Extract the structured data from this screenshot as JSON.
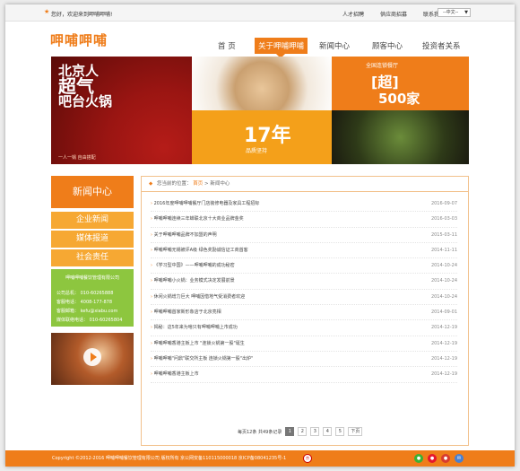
{
  "topbar": {
    "welcome": "您好，欢迎来到呷哺呷哺!",
    "links": [
      "人才招聘",
      "供应商招募",
      "联系我们"
    ],
    "language": "--中文--"
  },
  "header": {
    "logo": "呷哺呷哺",
    "nav": [
      {
        "label": "首 页"
      },
      {
        "label": "关于呷哺呷哺"
      },
      {
        "label": "新闻中心"
      },
      {
        "label": "顾客中心"
      },
      {
        "label": "投资者关系"
      }
    ]
  },
  "banner": {
    "panel1_line1": "北京人",
    "panel1_line2": "超气",
    "panel1_line3": "吧台火锅",
    "panel1_foot": "一人一锅 自由搭配",
    "panel3_num": "17年",
    "panel3_sub": "品质坚持",
    "panel4_line1": "全国连锁餐厅",
    "panel4_line2": "[超]",
    "panel4_line3": "500家"
  },
  "sidebar": {
    "title": "新闻中心",
    "items": [
      "企业新闻",
      "媒体报道",
      "社会责任"
    ],
    "contact": {
      "company": "呷哺呷哺餐饮管理有限公司",
      "phone": "公司总机： 010-60265888",
      "hotline": "客服电话： 4008-177-878",
      "email": "客服邮箱： kefu@xiabu.com",
      "media": "媒体联络电话： 010-60265804"
    }
  },
  "breadcrumb": {
    "prefix": "您当前的位置：",
    "home": "首页",
    "sep": ">",
    "current": "新闻中心"
  },
  "news": [
    {
      "title": "2016年度呷哺呷哺餐厅门店装修电器及家具工程招标",
      "date": "2016-09-07"
    },
    {
      "title": "呷哺呷哺连续三年蝉联北京十大商业品牌金奖",
      "date": "2016-03-03"
    },
    {
      "title": "关于呷哺呷哺品牌不加盟的声明",
      "date": "2015-03-11"
    },
    {
      "title": "呷哺呷哺无锡被评A级 绿色奖励诚信证工商首客",
      "date": "2014-11-11"
    },
    {
      "title": "《学习型中国》——呷哺呷哺的成功秘密",
      "date": "2014-10-24"
    },
    {
      "title": "呷哺呷哺小火锅：业务模式决定发展前景",
      "date": "2014-10-24"
    },
    {
      "title": "休闲火锅增力巨大 呷哺因借地气受消费者欢迎",
      "date": "2014-10-24"
    },
    {
      "title": "呷哺呷哺首家新形象店于北京亮相",
      "date": "2014-09-01"
    },
    {
      "title": "揭秘：这5年来为啥只有呷哺呷哺上市成功",
      "date": "2014-12-19"
    },
    {
      "title": "呷哺呷哺香港主板上市 \"连锁火锅第一股\"诞生",
      "date": "2014-12-19"
    },
    {
      "title": "呷哺呷哺\"问鼎\"联交所主板 连锁火锅第一股\"出炉\"",
      "date": "2014-12-19"
    },
    {
      "title": "呷哺呷哺香港主板上市",
      "date": "2014-12-19"
    }
  ],
  "pager": {
    "info": "每页12条 共49条记录",
    "pages": [
      "1",
      "2",
      "3",
      "4",
      "5"
    ],
    "next": "下页"
  },
  "footer": {
    "copyright": "Copyright ©2012-2016 呷哺呷哺餐饮管理有限公司  版权所有  京公网安备110115000018  京ICP备08041235号-1",
    "badge": "京"
  },
  "colors": {
    "accent": "#ef7d1a",
    "light_accent": "#f6a833",
    "contact_green": "#8dc63f"
  }
}
